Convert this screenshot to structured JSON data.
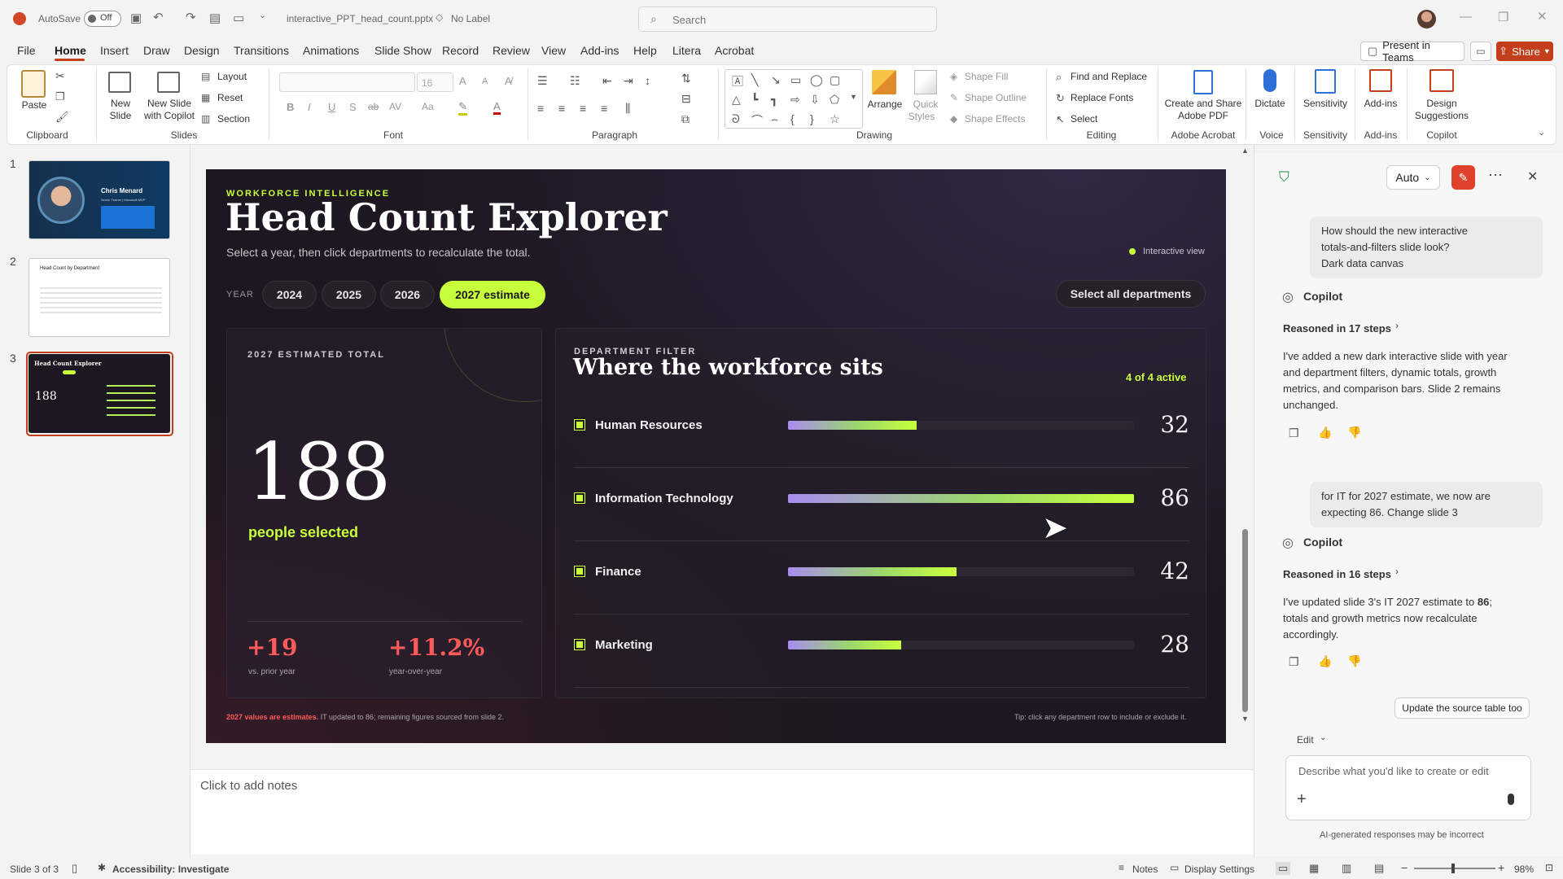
{
  "titlebar": {
    "autosave_label": "AutoSave",
    "autosave_state": "Off",
    "filename": "interactive_PPT_head_count.pptx",
    "label": "No Label",
    "search_placeholder": "Search"
  },
  "menu": {
    "tabs": [
      "File",
      "Home",
      "Insert",
      "Draw",
      "Design",
      "Transitions",
      "Animations",
      "Slide Show",
      "Record",
      "Review",
      "View",
      "Add-ins",
      "Help",
      "Litera",
      "Acrobat"
    ],
    "present_teams": "Present in Teams",
    "share": "Share"
  },
  "ribbon": {
    "paste": "Paste",
    "new_slide": "New Slide",
    "new_slide_copilot_1": "New Slide",
    "new_slide_copilot_2": "with Copilot",
    "layout": "Layout",
    "reset": "Reset",
    "section": "Section",
    "font_size": "16",
    "arrange": "Arrange",
    "quick_styles_1": "Quick",
    "quick_styles_2": "Styles",
    "shape_fill": "Shape Fill",
    "shape_outline": "Shape Outline",
    "shape_effects": "Shape Effects",
    "find_replace": "Find and Replace",
    "replace_fonts": "Replace Fonts",
    "select": "Select",
    "create_share_1": "Create and Share",
    "create_share_2": "Adobe PDF",
    "dictate": "Dictate",
    "sensitivity": "Sensitivity",
    "addins": "Add-ins",
    "design_sugg_1": "Design",
    "design_sugg_2": "Suggestions",
    "groups": {
      "clipboard": "Clipboard",
      "slides": "Slides",
      "font": "Font",
      "paragraph": "Paragraph",
      "drawing": "Drawing",
      "editing": "Editing",
      "adobe": "Adobe Acrobat",
      "voice": "Voice",
      "sensitivity": "Sensitivity",
      "addins": "Add-ins",
      "copilot": "Copilot"
    }
  },
  "thumbnails": {
    "numbers": [
      "1",
      "2",
      "3"
    ],
    "t1_name": "Chris Menard",
    "t1_sub": "Senior Trainer | Microsoft MVP",
    "t2_title": "Head Count by Department",
    "t3_title": "Head Count Explorer",
    "t3_big": "188"
  },
  "slide": {
    "eyebrow": "WORKFORCE INTELLIGENCE",
    "title": "Head Count Explorer",
    "subtitle": "Select a year, then click departments to recalculate the total.",
    "interactive_label": "Interactive view",
    "year_label": "YEAR",
    "years": [
      "2024",
      "2025",
      "2026",
      "2027 estimate"
    ],
    "select_all": "Select all departments",
    "total_label": "2027 ESTIMATED TOTAL",
    "total_value": "188",
    "total_caption": "people selected",
    "delta_abs": "+19",
    "delta_abs_caption": "vs. prior year",
    "delta_pct": "+11.2%",
    "delta_pct_caption": "year-over-year",
    "filter_eyebrow": "DEPARTMENT FILTER",
    "filter_title": "Where the workforce sits",
    "active_count": "4 of 4 active",
    "departments": [
      {
        "name": "Human Resources",
        "value": "32",
        "fill": 0.372
      },
      {
        "name": "Information Technology",
        "value": "86",
        "fill": 1.0
      },
      {
        "name": "Finance",
        "value": "42",
        "fill": 0.488
      },
      {
        "name": "Marketing",
        "value": "28",
        "fill": 0.326
      }
    ],
    "footnote_bold": "2027 values are estimates.",
    "footnote_rest": " IT updated to 86; remaining figures sourced from slide 2.",
    "tip": "Tip: click any department row to include or exclude it.",
    "colors": {
      "accent": "#c8ff3c",
      "alert": "#ff5a5a",
      "background": "#1c1720"
    }
  },
  "notes": {
    "placeholder": "Click to add notes"
  },
  "copilot": {
    "mode": "Auto",
    "user_msg1_l1": "How should the new interactive",
    "user_msg1_l2": "totals-and-filters slide look?",
    "user_msg1_l3": "Dark data canvas",
    "name": "Copilot",
    "reasoned1": "Reasoned in 17 steps",
    "reply1_l1": "I've added a new dark interactive slide with year",
    "reply1_l2": "and department filters, dynamic totals, growth",
    "reply1_l3": "metrics, and comparison bars. Slide 2 remains",
    "reply1_l4": "unchanged.",
    "user_msg2_l1": "for IT for 2027 estimate, we now are",
    "user_msg2_l2": "expecting 86. Change slide 3",
    "reasoned2": "Reasoned in 16 steps",
    "reply2_l1a": "I've updated slide 3's IT 2027 estimate to ",
    "reply2_l1b": "86",
    "reply2_l1c": ";",
    "reply2_l2": "totals and growth metrics now recalculate",
    "reply2_l3": "accordingly.",
    "suggestion": "Update the source table too",
    "edit_label": "Edit",
    "input_placeholder": "Describe what you'd like to create or edit",
    "disclaimer": "AI-generated responses may be incorrect"
  },
  "status": {
    "slide_of": "Slide 3 of 3",
    "accessibility": "Accessibility: Investigate",
    "notes": "Notes",
    "display_settings": "Display Settings",
    "zoom": "98%"
  }
}
